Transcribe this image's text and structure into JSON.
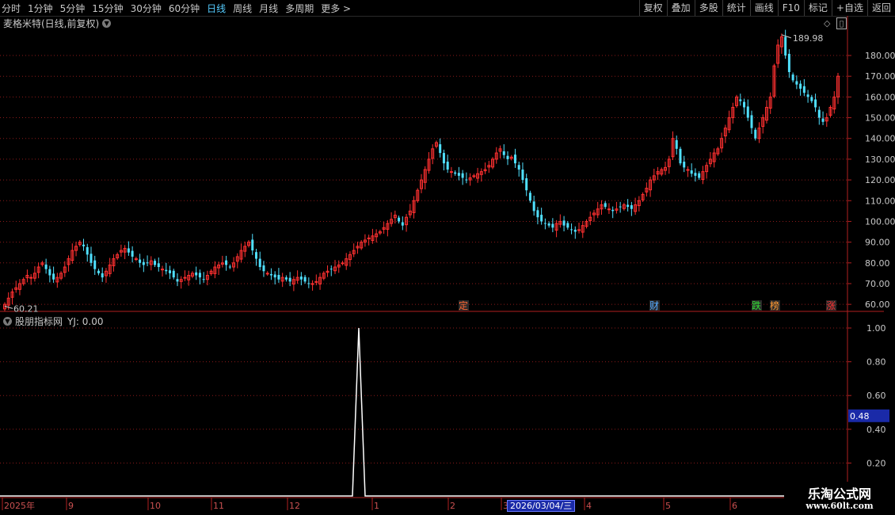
{
  "toolbar": {
    "periods": [
      "分时",
      "1分钟",
      "5分钟",
      "15分钟",
      "30分钟",
      "60分钟",
      "日线",
      "周线",
      "月线",
      "多周期",
      "更多 >"
    ],
    "active_period": "日线",
    "right_buttons": [
      "复权",
      "叠加",
      "多股",
      "统计",
      "画线",
      "F10",
      "标记",
      "+自选",
      "返回"
    ]
  },
  "stock_title": "麦格米特(日线,前复权)",
  "price_axis": {
    "ticks": [
      60,
      70,
      80,
      90,
      100,
      110,
      120,
      130,
      140,
      150,
      160,
      170,
      180
    ],
    "labels": [
      "60.00",
      "70.00",
      "80.00",
      "90.00",
      "100.00",
      "110.00",
      "120.00",
      "130.00",
      "140.00",
      "150.00",
      "160.00",
      "170.00",
      "180.00"
    ]
  },
  "high_marker": "189.98",
  "low_marker": "60.21",
  "event_tags": [
    {
      "text": "定",
      "color": "#ff6633"
    },
    {
      "text": "财",
      "color": "#55aaff"
    },
    {
      "text": "跌",
      "color": "#33dd33"
    },
    {
      "text": "榜",
      "color": "#ff9933"
    },
    {
      "text": "涨",
      "color": "#ff3333"
    }
  ],
  "indicator": {
    "name": "股朋指标网",
    "value_label": "YJ: 0.00",
    "axis_labels": [
      "1.00",
      "0.80",
      "0.60",
      "0.40",
      "0.20"
    ],
    "current_value": "0.48"
  },
  "time_axis": {
    "labels": [
      "2025年",
      "9",
      "10",
      "11",
      "12",
      "1",
      "2",
      "3",
      "4",
      "5",
      "6"
    ],
    "selected_date": "2026/03/04/三"
  },
  "watermark": {
    "line1": "乐淘公式网",
    "line2": "www.60lt.com"
  },
  "colors": {
    "up": "#ff3030",
    "down": "#50e0ff",
    "grid": "#8b1a1a",
    "axis": "#b02020",
    "indicator_line": "#ffffff"
  },
  "chart_data": {
    "type": "candlestick",
    "ylim": [
      57,
      193
    ],
    "series": [
      {
        "name": "price",
        "values": [
          60,
          63,
          66,
          68,
          70,
          72,
          74,
          73,
          75,
          78,
          80,
          77,
          74,
          72,
          73,
          75,
          78,
          82,
          86,
          88,
          90,
          88,
          84,
          80,
          77,
          75,
          73,
          76,
          79,
          82,
          84,
          86,
          87,
          85,
          83,
          82,
          80,
          79,
          80,
          81,
          79,
          78,
          77,
          76,
          75,
          73,
          71,
          72,
          73,
          74,
          75,
          74,
          73,
          72,
          74,
          76,
          78,
          79,
          80,
          79,
          78,
          80,
          83,
          86,
          88,
          90,
          86,
          82,
          78,
          76,
          75,
          74,
          73,
          72,
          73,
          72,
          71,
          72,
          73,
          72,
          71,
          70,
          70,
          71,
          73,
          75,
          76,
          77,
          78,
          79,
          80,
          82,
          84,
          86,
          88,
          90,
          91,
          92,
          93,
          94,
          95,
          97,
          99,
          101,
          103,
          100,
          98,
          102,
          105,
          110,
          115,
          120,
          125,
          130,
          135,
          138,
          133,
          128,
          125,
          124,
          123,
          122,
          121,
          120,
          121,
          122,
          123,
          124,
          125,
          127,
          130,
          133,
          135,
          132,
          130,
          131,
          128,
          125,
          120,
          115,
          110,
          105,
          102,
          100,
          99,
          98,
          97,
          99,
          100,
          98,
          97,
          96,
          95,
          96,
          98,
          100,
          102,
          104,
          106,
          108,
          107,
          106,
          105,
          106,
          107,
          108,
          107,
          106,
          108,
          110,
          113,
          116,
          120,
          122,
          124,
          125,
          126,
          130,
          140,
          135,
          128,
          126,
          125,
          123,
          122,
          121,
          124,
          127,
          130,
          133,
          135,
          140,
          145,
          150,
          155,
          160,
          158,
          155,
          150,
          145,
          140,
          145,
          150,
          155,
          160,
          175,
          185,
          189,
          180,
          172,
          168,
          166,
          164,
          162,
          160,
          158,
          155,
          150,
          148,
          150,
          155,
          160,
          170
        ]
      }
    ],
    "events": [
      "定",
      "财",
      "跌",
      "榜",
      "涨"
    ],
    "indicator_peak": 1.0
  }
}
